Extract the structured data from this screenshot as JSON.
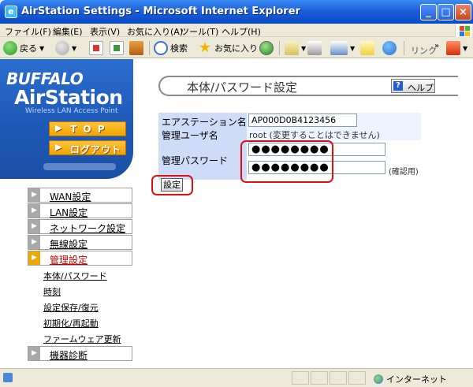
{
  "window": {
    "title": "AirStation Settings - Microsoft Internet Explorer",
    "icon": "ie-icon",
    "controls": [
      "minimize-icon",
      "maximize-icon",
      "close-icon"
    ]
  },
  "menubar": {
    "items": [
      "ファイル(F)",
      "編集(E)",
      "表示(V)",
      "お気に入り(A)",
      "ツール(T)",
      "ヘルプ(H)"
    ]
  },
  "toolbar": {
    "back": "戻る",
    "search": "検索",
    "favorites": "お気に入り",
    "links": "リンク"
  },
  "sidebar": {
    "brand": "BUFFALO",
    "product": "AirStation",
    "subtitle": "Wireless LAN Access Point",
    "top_button": "T O P",
    "logout_button": "ログアウト",
    "menu": [
      {
        "label": "WAN設定",
        "active": false
      },
      {
        "label": "LAN設定",
        "active": false
      },
      {
        "label": "ネットワーク設定",
        "active": false
      },
      {
        "label": "無線設定",
        "active": false
      },
      {
        "label": "管理設定",
        "active": true
      },
      {
        "label": "機器診断",
        "active": false
      }
    ],
    "submenu": [
      "本体/パスワード",
      "時刻",
      "設定保存/復元",
      "初期化/再起動",
      "ファームウェア更新"
    ]
  },
  "main": {
    "title": "本体/パスワード設定",
    "help_button": "ヘルプ",
    "form": {
      "station_name_label": "エアステーション名",
      "station_name_value": "AP000D0B4123456",
      "admin_user_label": "管理ユーザ名",
      "admin_user_value": "root (変更することはできません)",
      "admin_password_label": "管理パスワード",
      "password_value": "●●●●●●●●",
      "password_confirm_value": "●●●●●●●●",
      "confirm_note": "(確認用)",
      "submit_label": "設定"
    }
  },
  "statusbar": {
    "zone": "インターネット"
  },
  "colors": {
    "title_bar": "#1d5fd8",
    "sidebar_blue": "#2a6ed0",
    "nav_orange": "#f2a400",
    "active_menu_text": "#c00000",
    "highlight_red": "#e01010",
    "form_label_bg": "#cfdcf7"
  }
}
